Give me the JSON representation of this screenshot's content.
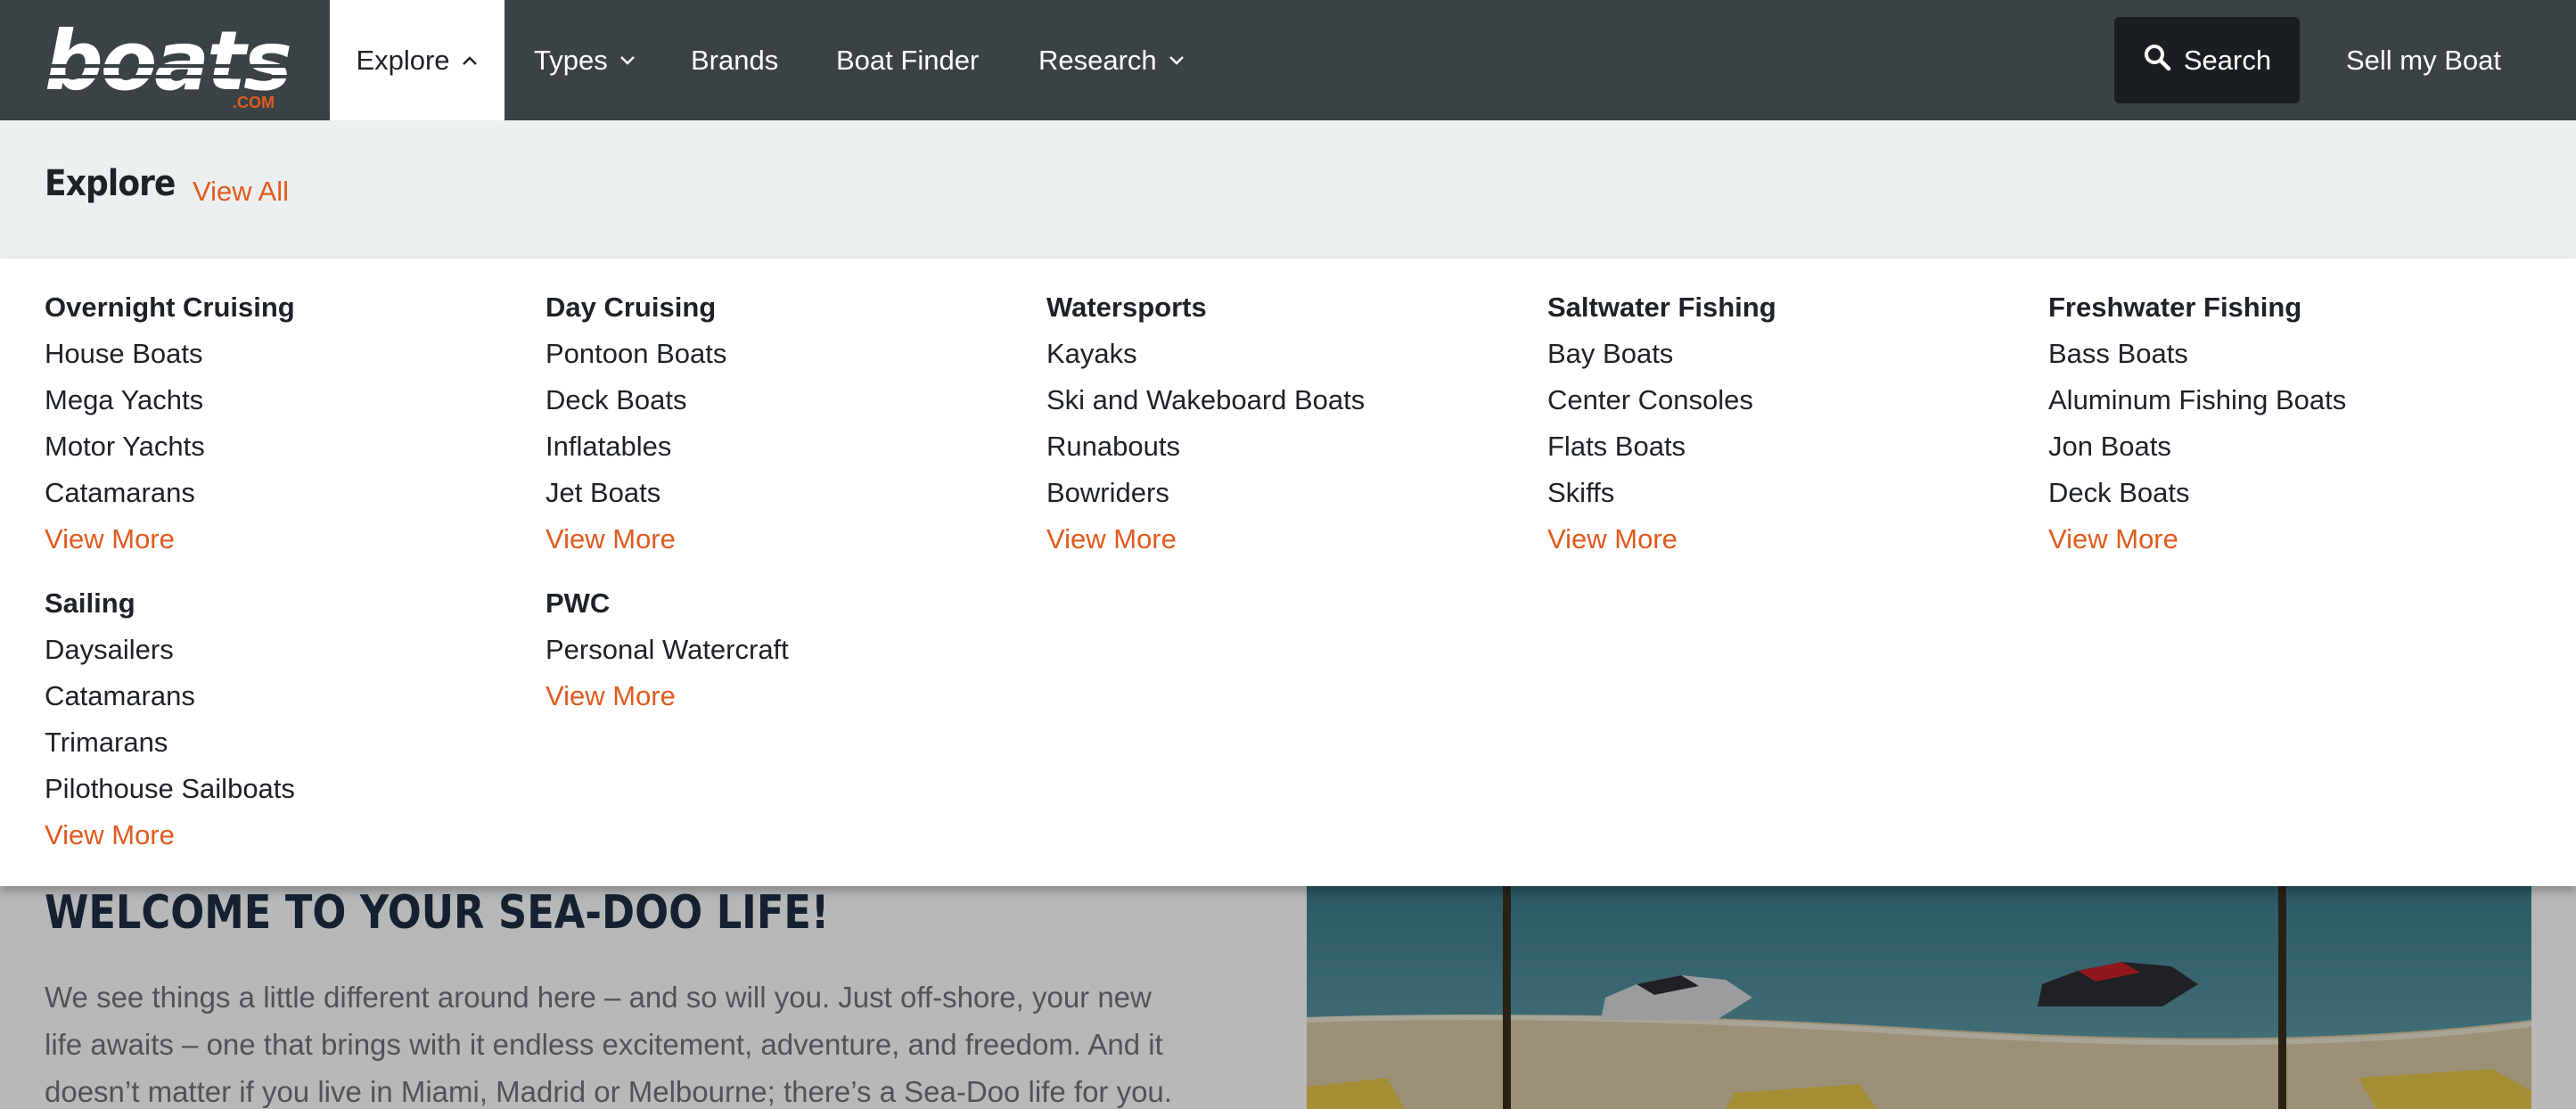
{
  "brand": {
    "logo_text": "boats",
    "logo_suffix": ".COM",
    "accent": "#e05b1e",
    "nav_bg": "#3a4245"
  },
  "nav": {
    "items": [
      {
        "label": "Explore",
        "active": true,
        "has_chevron": true,
        "chevron": "chevron-up-icon"
      },
      {
        "label": "Types",
        "active": false,
        "has_chevron": true,
        "chevron": "chevron-down-icon"
      },
      {
        "label": "Brands",
        "active": false,
        "has_chevron": false
      },
      {
        "label": "Boat Finder",
        "active": false,
        "has_chevron": false
      },
      {
        "label": "Research",
        "active": false,
        "has_chevron": true,
        "chevron": "chevron-down-icon"
      }
    ],
    "search_label": "Search",
    "search_icon": "search-icon",
    "sell_label": "Sell my Boat"
  },
  "mega_menu": {
    "title": "Explore",
    "view_all": "View All",
    "categories": [
      {
        "heading": "Overnight Cruising",
        "links": [
          "House Boats",
          "Mega Yachts",
          "Motor Yachts",
          "Catamarans"
        ],
        "more": "View More"
      },
      {
        "heading": "Day Cruising",
        "links": [
          "Pontoon Boats",
          "Deck Boats",
          "Inflatables",
          "Jet Boats"
        ],
        "more": "View More"
      },
      {
        "heading": "Watersports",
        "links": [
          "Kayaks",
          "Ski and Wakeboard Boats",
          "Runabouts",
          "Bowriders"
        ],
        "more": "View More"
      },
      {
        "heading": "Saltwater Fishing",
        "links": [
          "Bay Boats",
          "Center Consoles",
          "Flats Boats",
          "Skiffs"
        ],
        "more": "View More"
      },
      {
        "heading": "Freshwater Fishing",
        "links": [
          "Bass Boats",
          "Aluminum Fishing Boats",
          "Jon Boats",
          "Deck Boats"
        ],
        "more": "View More"
      },
      {
        "heading": "Sailing",
        "links": [
          "Daysailers",
          "Catamarans",
          "Trimarans",
          "Pilothouse Sailboats"
        ],
        "more": "View More"
      },
      {
        "heading": "PWC",
        "links": [
          "Personal Watercraft"
        ],
        "more": "View More"
      }
    ]
  },
  "page": {
    "headline": "WELCOME TO YOUR SEA-DOO LIFE!",
    "intro_lines": [
      "We see things a little different around here – and so will you. Just off-shore, your new",
      "life awaits – one that brings with it endless excitement, adventure, and freedom. And it",
      "doesn’t matter if you live in Miami, Madrid or Melbourne; there’s a Sea-Doo life for you."
    ]
  }
}
